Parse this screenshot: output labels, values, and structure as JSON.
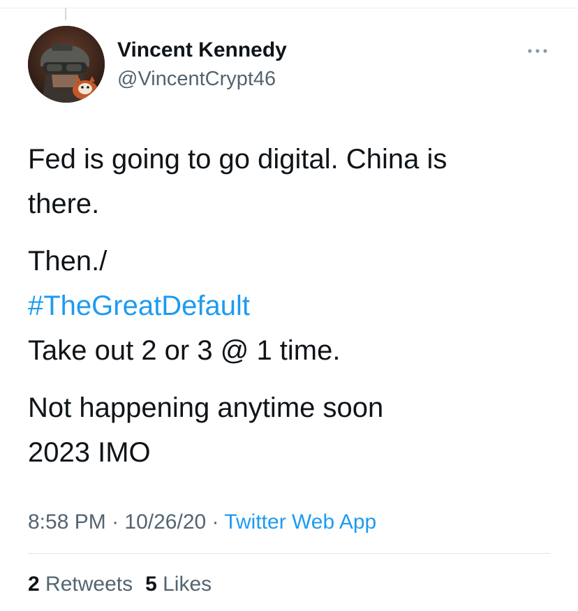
{
  "author": {
    "display_name": "Vincent Kennedy",
    "handle": "@VincentCrypt46",
    "avatar_icon": "soldier-with-red-panda-avatar"
  },
  "more_icon": "more-horizontal-icon",
  "tweet": {
    "paragraphs": [
      {
        "lines": [
          "Fed is going to go digital. China is",
          "there."
        ]
      },
      {
        "lines": [
          "Then./"
        ],
        "hashtag": "#TheGreatDefault",
        "after": [
          "Take out 2 or 3 @ 1 time."
        ]
      },
      {
        "lines": [
          "Not happening anytime soon",
          "2023 IMO"
        ]
      }
    ]
  },
  "meta": {
    "time": "8:58 PM",
    "separator": "·",
    "date": "10/26/20",
    "source": "Twitter Web App"
  },
  "stats": {
    "retweets_count": "2",
    "retweets_label": "Retweets",
    "likes_count": "5",
    "likes_label": "Likes"
  },
  "colors": {
    "link": "#1d9bf0",
    "text_primary": "#0f1419",
    "text_secondary": "#536471"
  }
}
